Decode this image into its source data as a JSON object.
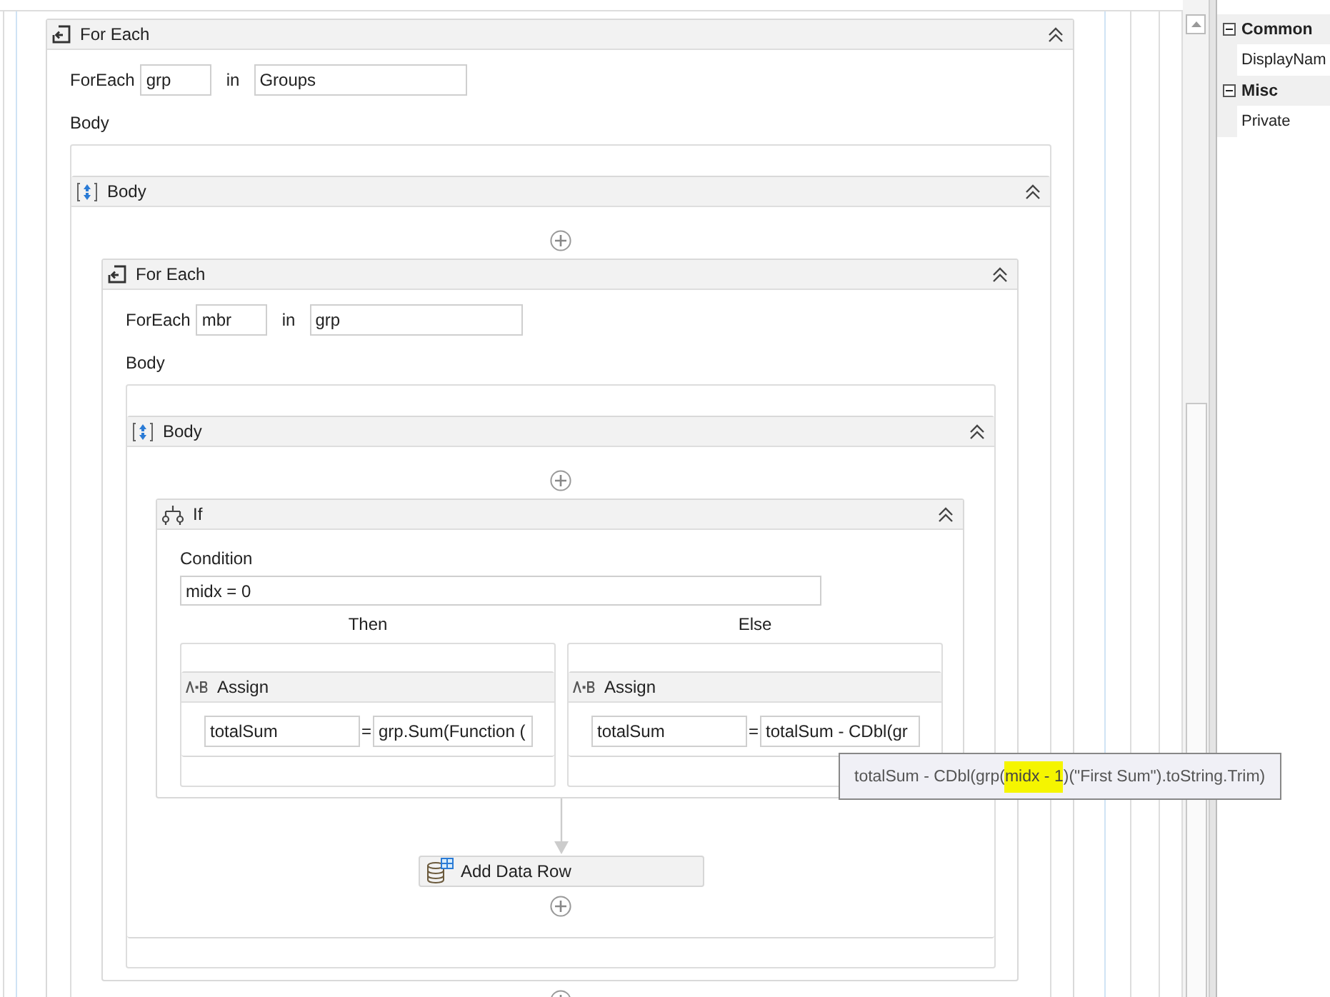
{
  "designer": {
    "activity": {
      "kind": "foreach",
      "title": "For Each",
      "item_label": "ForEach",
      "item": "grp",
      "in_label": "in",
      "collection": "Groups",
      "body_label": "Body",
      "body": {
        "kind": "sequence",
        "title": "Body",
        "activities": [
          {
            "kind": "foreach",
            "title": "For Each",
            "item_label": "ForEach",
            "item": "mbr",
            "in_label": "in",
            "collection": "grp",
            "body_label": "Body",
            "body": {
              "kind": "sequence",
              "title": "Body",
              "activities": [
                {
                  "kind": "if",
                  "title": "If",
                  "condition_label": "Condition",
                  "condition": "midx = 0",
                  "then_label": "Then",
                  "else_label": "Else",
                  "then": {
                    "kind": "assign",
                    "title": "Assign",
                    "to": "totalSum",
                    "equals": "=",
                    "value": "grp.Sum(Function ("
                  },
                  "else": {
                    "kind": "assign",
                    "title": "Assign",
                    "to": "totalSum",
                    "equals": "=",
                    "value": "totalSum - CDbl(gr"
                  }
                },
                {
                  "kind": "activity",
                  "title": "Add Data Row"
                }
              ]
            }
          }
        ]
      }
    }
  },
  "tooltip": {
    "segments": [
      {
        "text": "totalSum - CDbl(grp(",
        "highlighted": false
      },
      {
        "text": "midx - 1",
        "highlighted": true
      },
      {
        "text": ")(\"First Sum\").toString.Trim)",
        "highlighted": false
      }
    ]
  },
  "properties": {
    "categories": [
      {
        "name": "Common",
        "expanded": true,
        "rows": [
          "DisplayNam"
        ]
      },
      {
        "name": "Misc",
        "expanded": true,
        "rows": [
          "Private"
        ]
      }
    ]
  }
}
